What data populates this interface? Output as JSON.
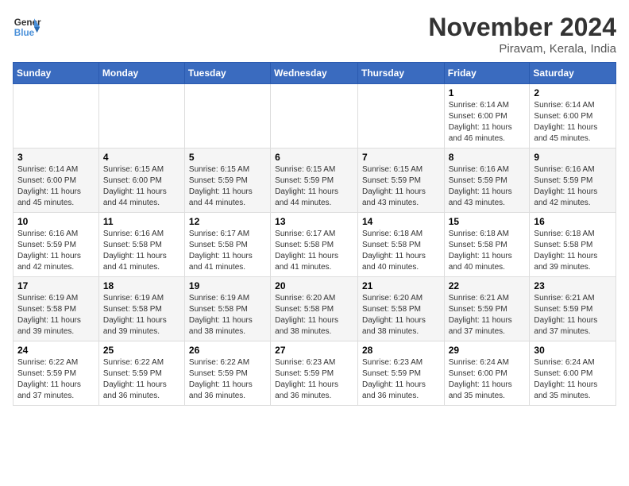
{
  "header": {
    "logo_line1": "General",
    "logo_line2": "Blue",
    "month_title": "November 2024",
    "location": "Piravam, Kerala, India"
  },
  "weekdays": [
    "Sunday",
    "Monday",
    "Tuesday",
    "Wednesday",
    "Thursday",
    "Friday",
    "Saturday"
  ],
  "weeks": [
    [
      {
        "day": "",
        "info": ""
      },
      {
        "day": "",
        "info": ""
      },
      {
        "day": "",
        "info": ""
      },
      {
        "day": "",
        "info": ""
      },
      {
        "day": "",
        "info": ""
      },
      {
        "day": "1",
        "info": "Sunrise: 6:14 AM\nSunset: 6:00 PM\nDaylight: 11 hours and 46 minutes."
      },
      {
        "day": "2",
        "info": "Sunrise: 6:14 AM\nSunset: 6:00 PM\nDaylight: 11 hours and 45 minutes."
      }
    ],
    [
      {
        "day": "3",
        "info": "Sunrise: 6:14 AM\nSunset: 6:00 PM\nDaylight: 11 hours and 45 minutes."
      },
      {
        "day": "4",
        "info": "Sunrise: 6:15 AM\nSunset: 6:00 PM\nDaylight: 11 hours and 44 minutes."
      },
      {
        "day": "5",
        "info": "Sunrise: 6:15 AM\nSunset: 5:59 PM\nDaylight: 11 hours and 44 minutes."
      },
      {
        "day": "6",
        "info": "Sunrise: 6:15 AM\nSunset: 5:59 PM\nDaylight: 11 hours and 44 minutes."
      },
      {
        "day": "7",
        "info": "Sunrise: 6:15 AM\nSunset: 5:59 PM\nDaylight: 11 hours and 43 minutes."
      },
      {
        "day": "8",
        "info": "Sunrise: 6:16 AM\nSunset: 5:59 PM\nDaylight: 11 hours and 43 minutes."
      },
      {
        "day": "9",
        "info": "Sunrise: 6:16 AM\nSunset: 5:59 PM\nDaylight: 11 hours and 42 minutes."
      }
    ],
    [
      {
        "day": "10",
        "info": "Sunrise: 6:16 AM\nSunset: 5:59 PM\nDaylight: 11 hours and 42 minutes."
      },
      {
        "day": "11",
        "info": "Sunrise: 6:16 AM\nSunset: 5:58 PM\nDaylight: 11 hours and 41 minutes."
      },
      {
        "day": "12",
        "info": "Sunrise: 6:17 AM\nSunset: 5:58 PM\nDaylight: 11 hours and 41 minutes."
      },
      {
        "day": "13",
        "info": "Sunrise: 6:17 AM\nSunset: 5:58 PM\nDaylight: 11 hours and 41 minutes."
      },
      {
        "day": "14",
        "info": "Sunrise: 6:18 AM\nSunset: 5:58 PM\nDaylight: 11 hours and 40 minutes."
      },
      {
        "day": "15",
        "info": "Sunrise: 6:18 AM\nSunset: 5:58 PM\nDaylight: 11 hours and 40 minutes."
      },
      {
        "day": "16",
        "info": "Sunrise: 6:18 AM\nSunset: 5:58 PM\nDaylight: 11 hours and 39 minutes."
      }
    ],
    [
      {
        "day": "17",
        "info": "Sunrise: 6:19 AM\nSunset: 5:58 PM\nDaylight: 11 hours and 39 minutes."
      },
      {
        "day": "18",
        "info": "Sunrise: 6:19 AM\nSunset: 5:58 PM\nDaylight: 11 hours and 39 minutes."
      },
      {
        "day": "19",
        "info": "Sunrise: 6:19 AM\nSunset: 5:58 PM\nDaylight: 11 hours and 38 minutes."
      },
      {
        "day": "20",
        "info": "Sunrise: 6:20 AM\nSunset: 5:58 PM\nDaylight: 11 hours and 38 minutes."
      },
      {
        "day": "21",
        "info": "Sunrise: 6:20 AM\nSunset: 5:58 PM\nDaylight: 11 hours and 38 minutes."
      },
      {
        "day": "22",
        "info": "Sunrise: 6:21 AM\nSunset: 5:59 PM\nDaylight: 11 hours and 37 minutes."
      },
      {
        "day": "23",
        "info": "Sunrise: 6:21 AM\nSunset: 5:59 PM\nDaylight: 11 hours and 37 minutes."
      }
    ],
    [
      {
        "day": "24",
        "info": "Sunrise: 6:22 AM\nSunset: 5:59 PM\nDaylight: 11 hours and 37 minutes."
      },
      {
        "day": "25",
        "info": "Sunrise: 6:22 AM\nSunset: 5:59 PM\nDaylight: 11 hours and 36 minutes."
      },
      {
        "day": "26",
        "info": "Sunrise: 6:22 AM\nSunset: 5:59 PM\nDaylight: 11 hours and 36 minutes."
      },
      {
        "day": "27",
        "info": "Sunrise: 6:23 AM\nSunset: 5:59 PM\nDaylight: 11 hours and 36 minutes."
      },
      {
        "day": "28",
        "info": "Sunrise: 6:23 AM\nSunset: 5:59 PM\nDaylight: 11 hours and 36 minutes."
      },
      {
        "day": "29",
        "info": "Sunrise: 6:24 AM\nSunset: 6:00 PM\nDaylight: 11 hours and 35 minutes."
      },
      {
        "day": "30",
        "info": "Sunrise: 6:24 AM\nSunset: 6:00 PM\nDaylight: 11 hours and 35 minutes."
      }
    ]
  ]
}
